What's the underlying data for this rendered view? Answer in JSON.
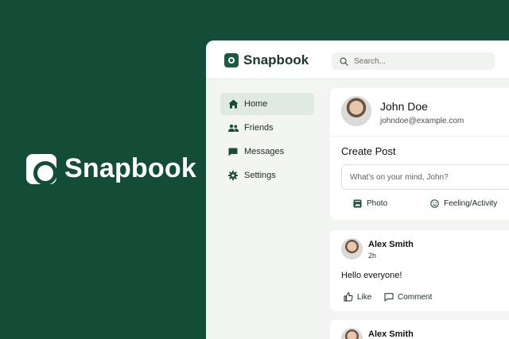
{
  "hero": {
    "brand": "Snapbook"
  },
  "header": {
    "brand": "Snapbook",
    "search_placeholder": "Search..."
  },
  "sidebar": {
    "items": [
      {
        "label": "Home",
        "icon": "home-icon",
        "active": true
      },
      {
        "label": "Friends",
        "icon": "friends-icon"
      },
      {
        "label": "Messages",
        "icon": "messages-icon"
      },
      {
        "label": "Settings",
        "icon": "settings-icon"
      }
    ]
  },
  "profile": {
    "name": "John Doe",
    "email": "johndoe@example.com"
  },
  "create_post": {
    "title": "Create Post",
    "placeholder": "What's on your mind, John?",
    "photo_label": "Photo",
    "feeling_label": "Feeling/Activity"
  },
  "feed": [
    {
      "author": "Alex Smith",
      "time": "2h",
      "text": "Hello everyone!",
      "like_label": "Like",
      "comment_label": "Comment"
    },
    {
      "author": "Alex Smith"
    }
  ],
  "colors": {
    "brand_green": "#134d37",
    "accent_green": "#1a5a3e",
    "nav_active": "#e1e9e3"
  }
}
